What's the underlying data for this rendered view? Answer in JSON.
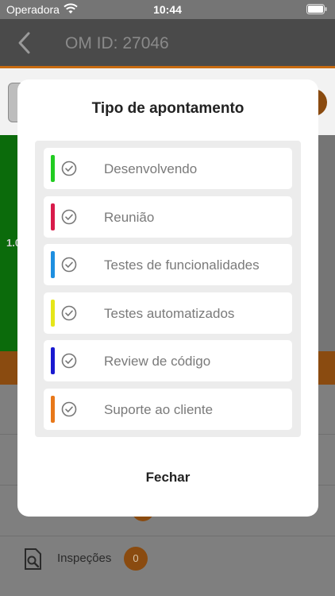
{
  "status_bar": {
    "carrier": "Operadora",
    "time": "10:44"
  },
  "nav": {
    "title": "OM ID: 27046"
  },
  "background": {
    "partial_value": "1.0",
    "inspecoes_label": "Inspeções",
    "inspecoes_count": "0"
  },
  "modal": {
    "title": "Tipo de apontamento",
    "options": [
      {
        "label": "Desenvolvendo",
        "color": "#22cc22"
      },
      {
        "label": "Reunião",
        "color": "#d81b4a"
      },
      {
        "label": "Testes de funcionalidades",
        "color": "#1e8fe0"
      },
      {
        "label": "Testes automatizados",
        "color": "#e6e619"
      },
      {
        "label": "Review de código",
        "color": "#1a1ad0"
      },
      {
        "label": "Suporte ao cliente",
        "color": "#e8781a"
      }
    ],
    "close_label": "Fechar"
  },
  "colors": {
    "accent": "#e8781a",
    "overlay": "#7f7f7f"
  }
}
